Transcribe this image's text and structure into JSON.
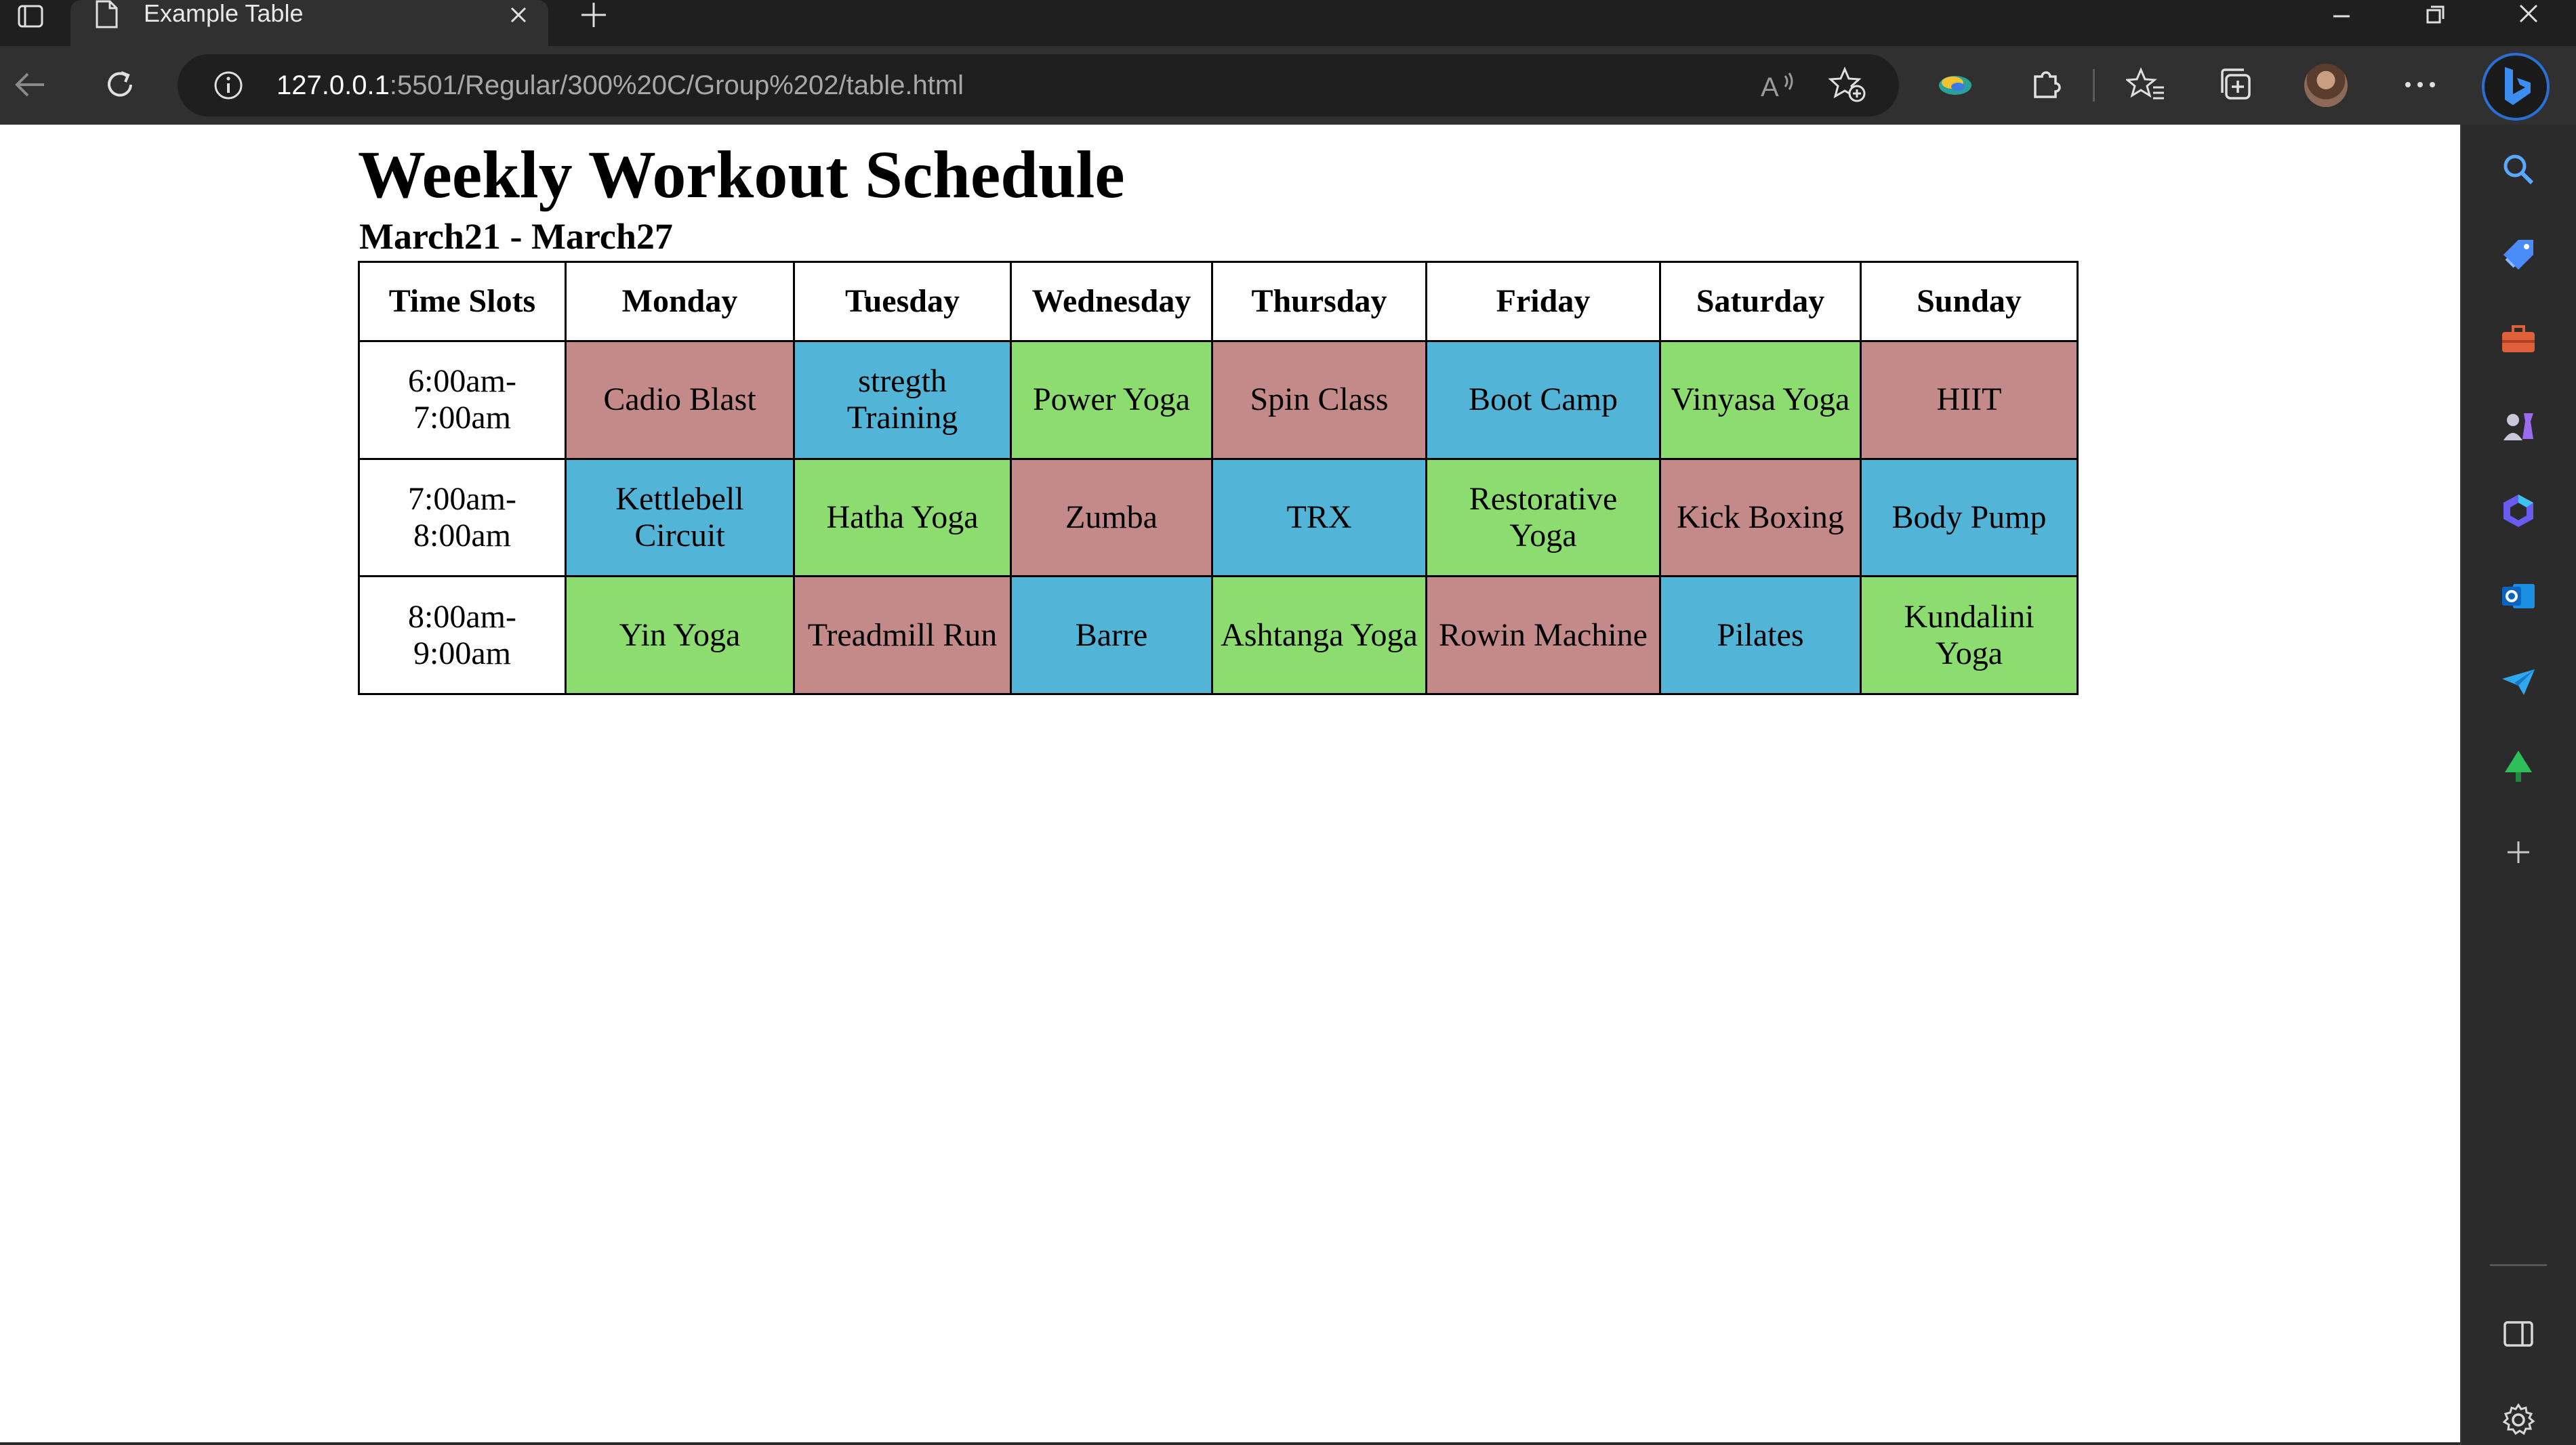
{
  "browser": {
    "tab_title": "Example Table",
    "url_host": "127.0.0.1",
    "url_path": ":5501/Regular/300%20C/Group%202/table.html",
    "icons": {
      "tab_actions": "tab-actions-icon",
      "page": "page-icon",
      "close": "close-icon",
      "new_tab": "plus-icon",
      "minimize": "minimize-icon",
      "restore": "restore-icon",
      "window_close": "close-icon",
      "back": "back-arrow-icon",
      "refresh": "refresh-icon",
      "info": "info-icon",
      "read_aloud": "read-aloud-icon",
      "add_favorite": "add-favorite-icon",
      "extension_ball": "extension-icon",
      "extensions": "puzzle-icon",
      "favorites": "favorites-icon",
      "collections": "collections-icon",
      "more": "more-icon",
      "bing": "bing-icon"
    }
  },
  "sidebar": {
    "icons": [
      "search-icon",
      "shopping-tag-icon",
      "toolbox-icon",
      "games-icon",
      "copilot-icon",
      "outlook-icon",
      "send-icon",
      "tree-icon",
      "add-icon",
      "sidebar-toggle-icon",
      "settings-icon"
    ]
  },
  "page": {
    "title": "Weekly Workout Schedule",
    "subtitle": "March21 - March27",
    "table": {
      "headers": [
        "Time Slots",
        "Monday",
        "Tuesday",
        "Wednesday",
        "Thursday",
        "Friday",
        "Saturday",
        "Sunday"
      ],
      "rows": [
        {
          "time": "6:00am-7:00am",
          "cells": [
            "Cadio Blast",
            "stregth Training",
            "Power Yoga",
            "Spin Class",
            "Boot Camp",
            "Vinyasa Yoga",
            "HIIT"
          ],
          "colors": [
            "rose",
            "blue",
            "green",
            "rose",
            "blue",
            "green",
            "rose"
          ]
        },
        {
          "time": "7:00am-8:00am",
          "cells": [
            "Kettlebell Circuit",
            "Hatha Yoga",
            "Zumba",
            "TRX",
            "Restorative Yoga",
            "Kick Boxing",
            "Body Pump"
          ],
          "colors": [
            "blue",
            "green",
            "rose",
            "blue",
            "green",
            "rose",
            "blue"
          ]
        },
        {
          "time": "8:00am-9:00am",
          "cells": [
            "Yin Yoga",
            "Treadmill Run",
            "Barre",
            "Ashtanga Yoga",
            "Rowin Machine",
            "Pilates",
            "Kundalini Yoga"
          ],
          "colors": [
            "green",
            "rose",
            "blue",
            "green",
            "rose",
            "blue",
            "green"
          ]
        }
      ]
    },
    "colors": {
      "rose": "#c48a89",
      "blue": "#52b4d6",
      "green": "#8ddc70"
    }
  }
}
